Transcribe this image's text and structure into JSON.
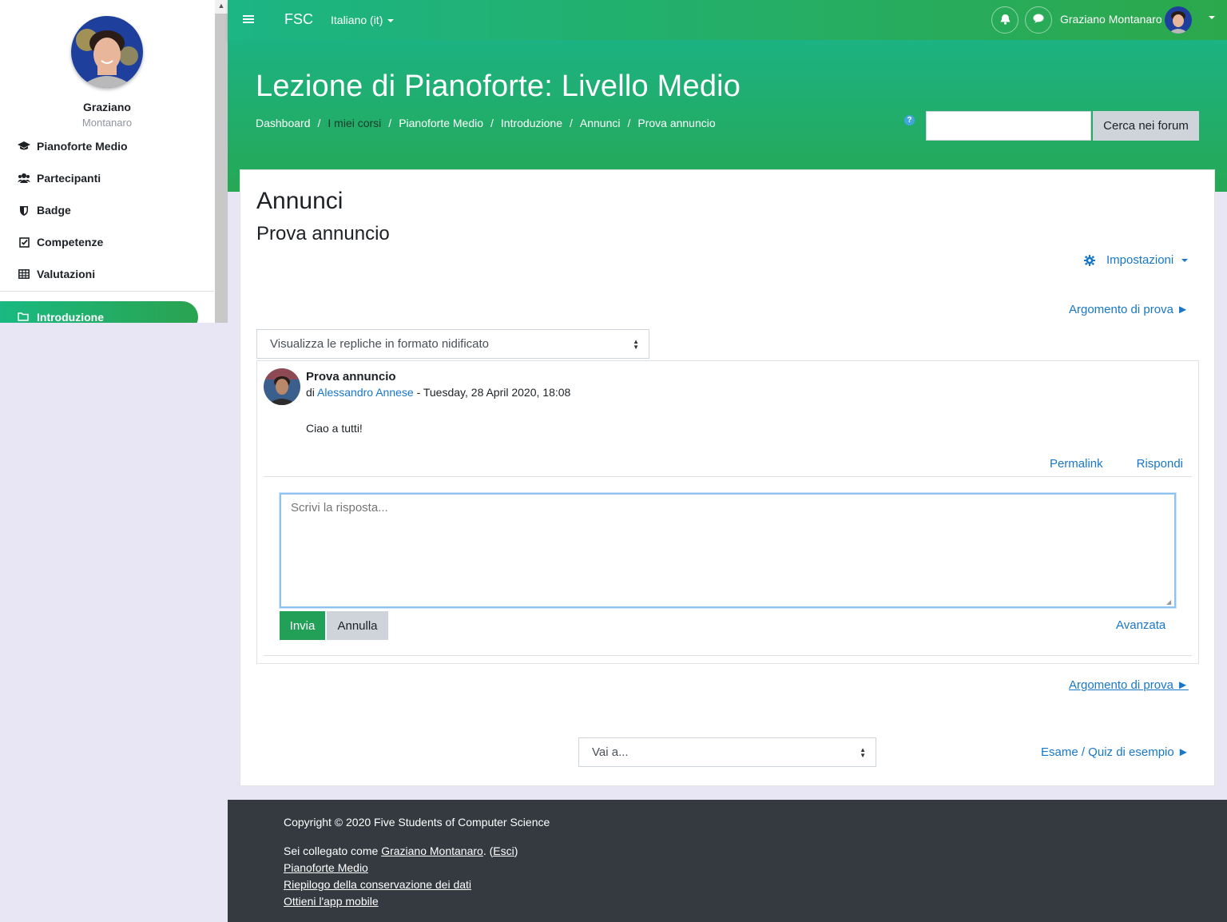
{
  "sidebar": {
    "user_first": "Graziano",
    "user_last": "Montanaro",
    "items": [
      {
        "label": "Pianoforte Medio",
        "icon": "graduation-cap-icon"
      },
      {
        "label": "Partecipanti",
        "icon": "users-icon"
      },
      {
        "label": "Badge",
        "icon": "shield-icon"
      },
      {
        "label": "Competenze",
        "icon": "check-square-icon"
      },
      {
        "label": "Valutazioni",
        "icon": "table-icon"
      }
    ],
    "active_item": {
      "label": "Introduzione",
      "icon": "folder-icon"
    }
  },
  "navbar": {
    "brand": "FSC",
    "language": "Italiano (it)",
    "user_name": "Graziano Montanaro"
  },
  "header": {
    "course_title": "Lezione di Pianoforte: Livello Medio",
    "breadcrumb": [
      "Dashboard",
      "I miei corsi",
      "Pianoforte Medio",
      "Introduzione",
      "Annunci",
      "Prova annuncio"
    ],
    "search_placeholder": "",
    "search_button": "Cerca nei forum"
  },
  "main": {
    "forum_title": "Annunci",
    "discussion_title": "Prova annuncio",
    "settings_label": "Impostazioni",
    "next_discussion": "Argomento di prova ►",
    "display_mode": "Visualizza le repliche in formato nidificato",
    "post": {
      "subject": "Prova annuncio",
      "by_prefix": "di",
      "author": "Alessandro Annese",
      "date": "- Tuesday, 28 April 2020, 18:08",
      "message": "Ciao a tutti!",
      "permalink": "Permalink",
      "reply": "Rispondi"
    },
    "reply_form": {
      "placeholder": "Scrivi la risposta...",
      "submit": "Invia",
      "cancel": "Annulla",
      "advanced": "Avanzata"
    },
    "jump_to": "Vai a...",
    "next_activity": "Esame / Quiz di esempio ►"
  },
  "footer": {
    "copyright": "Copyright © 2020 Five Students of Computer Science",
    "logged_prefix": "Sei collegato come",
    "logged_user": "Graziano Montanaro",
    "logout_open": ". (",
    "logout": "Esci",
    "logout_close": ")",
    "links": [
      "Pianoforte Medio",
      "Riepilogo della conservazione dei dati",
      "Ottieni l'app mobile"
    ]
  },
  "colors": {
    "accent_green": "#22a058",
    "link_blue": "#1877c9",
    "footer_bg": "#343a40",
    "page_bg": "#e8e6f5"
  }
}
